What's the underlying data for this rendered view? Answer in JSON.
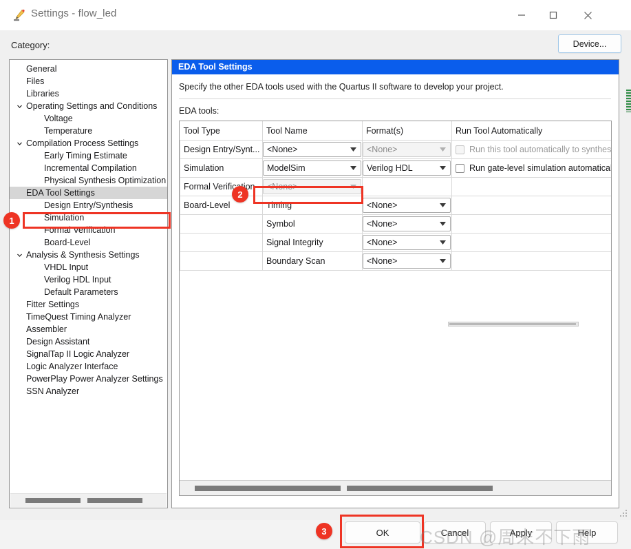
{
  "window": {
    "title": "Settings - flow_led",
    "icon": "pencil-ruler-icon",
    "minimize": "–",
    "maximize": "□",
    "close": "×"
  },
  "category": {
    "label": "Category:",
    "items": [
      {
        "label": "General",
        "level": 1,
        "expandable": false,
        "selected": false
      },
      {
        "label": "Files",
        "level": 1,
        "expandable": false,
        "selected": false
      },
      {
        "label": "Libraries",
        "level": 1,
        "expandable": false,
        "selected": false
      },
      {
        "label": "Operating Settings and Conditions",
        "level": 1,
        "expandable": true,
        "selected": false
      },
      {
        "label": "Voltage",
        "level": 2,
        "expandable": false,
        "selected": false
      },
      {
        "label": "Temperature",
        "level": 2,
        "expandable": false,
        "selected": false
      },
      {
        "label": "Compilation Process Settings",
        "level": 1,
        "expandable": true,
        "selected": false
      },
      {
        "label": "Early Timing Estimate",
        "level": 2,
        "expandable": false,
        "selected": false
      },
      {
        "label": "Incremental Compilation",
        "level": 2,
        "expandable": false,
        "selected": false
      },
      {
        "label": "Physical Synthesis Optimization",
        "level": 2,
        "expandable": false,
        "selected": false
      },
      {
        "label": "EDA Tool Settings",
        "level": 1,
        "expandable": false,
        "selected": true
      },
      {
        "label": "Design Entry/Synthesis",
        "level": 2,
        "expandable": false,
        "selected": false
      },
      {
        "label": "Simulation",
        "level": 2,
        "expandable": false,
        "selected": false
      },
      {
        "label": "Formal Verification",
        "level": 2,
        "expandable": false,
        "selected": false
      },
      {
        "label": "Board-Level",
        "level": 2,
        "expandable": false,
        "selected": false
      },
      {
        "label": "Analysis & Synthesis Settings",
        "level": 1,
        "expandable": true,
        "selected": false
      },
      {
        "label": "VHDL Input",
        "level": 2,
        "expandable": false,
        "selected": false
      },
      {
        "label": "Verilog HDL Input",
        "level": 2,
        "expandable": false,
        "selected": false
      },
      {
        "label": "Default Parameters",
        "level": 2,
        "expandable": false,
        "selected": false
      },
      {
        "label": "Fitter Settings",
        "level": 1,
        "expandable": false,
        "selected": false
      },
      {
        "label": "TimeQuest Timing Analyzer",
        "level": 1,
        "expandable": false,
        "selected": false
      },
      {
        "label": "Assembler",
        "level": 1,
        "expandable": false,
        "selected": false
      },
      {
        "label": "Design Assistant",
        "level": 1,
        "expandable": false,
        "selected": false
      },
      {
        "label": "SignalTap II Logic Analyzer",
        "level": 1,
        "expandable": false,
        "selected": false
      },
      {
        "label": "Logic Analyzer Interface",
        "level": 1,
        "expandable": false,
        "selected": false
      },
      {
        "label": "PowerPlay Power Analyzer Settings",
        "level": 1,
        "expandable": false,
        "selected": false
      },
      {
        "label": "SSN Analyzer",
        "level": 1,
        "expandable": false,
        "selected": false
      }
    ]
  },
  "device_button": {
    "label": "Device..."
  },
  "panel": {
    "header": "EDA Tool Settings",
    "description": "Specify the other EDA tools used with the Quartus II software to develop your project.",
    "table_label": "EDA tools:"
  },
  "table": {
    "headers": [
      "Tool Type",
      "Tool Name",
      "Format(s)",
      "Run Tool Automatically"
    ],
    "rows": [
      {
        "tool_type": "Design Entry/Synt...",
        "tool_name": {
          "value": "<None>",
          "type": "combo",
          "disabled": false
        },
        "format": {
          "value": "<None>",
          "type": "combo",
          "disabled": true
        },
        "run": {
          "type": "checkbox",
          "checked": false,
          "disabled": true,
          "label": "Run this tool automatically to synthesiz"
        }
      },
      {
        "tool_type": "Simulation",
        "tool_name": {
          "value": "ModelSim",
          "type": "combo",
          "disabled": false
        },
        "format": {
          "value": "Verilog HDL",
          "type": "combo",
          "disabled": false
        },
        "run": {
          "type": "checkbox",
          "checked": false,
          "disabled": false,
          "label": "Run gate-level simulation automaticall"
        }
      },
      {
        "tool_type": "Formal Verification",
        "tool_name": {
          "value": "<None>",
          "type": "combo",
          "disabled": true
        },
        "format": {
          "value": "",
          "type": "empty",
          "disabled": true
        },
        "run": {
          "type": "none",
          "checked": false,
          "disabled": true,
          "label": ""
        }
      },
      {
        "tool_type": "Board-Level",
        "tool_name": {
          "value": "Timing",
          "type": "text",
          "disabled": false
        },
        "format": {
          "value": "<None>",
          "type": "combo",
          "disabled": false
        },
        "run": {
          "type": "none",
          "checked": false,
          "disabled": false,
          "label": ""
        }
      },
      {
        "tool_type": "",
        "tool_name": {
          "value": "Symbol",
          "type": "text",
          "disabled": false
        },
        "format": {
          "value": "<None>",
          "type": "combo",
          "disabled": false
        },
        "run": {
          "type": "none",
          "checked": false,
          "disabled": false,
          "label": ""
        }
      },
      {
        "tool_type": "",
        "tool_name": {
          "value": "Signal Integrity",
          "type": "text",
          "disabled": false
        },
        "format": {
          "value": "<None>",
          "type": "combo",
          "disabled": false
        },
        "run": {
          "type": "none",
          "checked": false,
          "disabled": false,
          "label": ""
        }
      },
      {
        "tool_type": "",
        "tool_name": {
          "value": "Boundary Scan",
          "type": "text",
          "disabled": false
        },
        "format": {
          "value": "<None>",
          "type": "combo",
          "disabled": false
        },
        "run": {
          "type": "none",
          "checked": false,
          "disabled": false,
          "label": ""
        }
      }
    ]
  },
  "buttons": {
    "ok": "OK",
    "cancel": "Cancel",
    "apply": "Apply",
    "help": "Help"
  },
  "annotations": {
    "step1": "1",
    "step2": "2",
    "step3": "3",
    "accent_color": "#ee3424"
  },
  "watermark": "CSDN @周末不下雨"
}
